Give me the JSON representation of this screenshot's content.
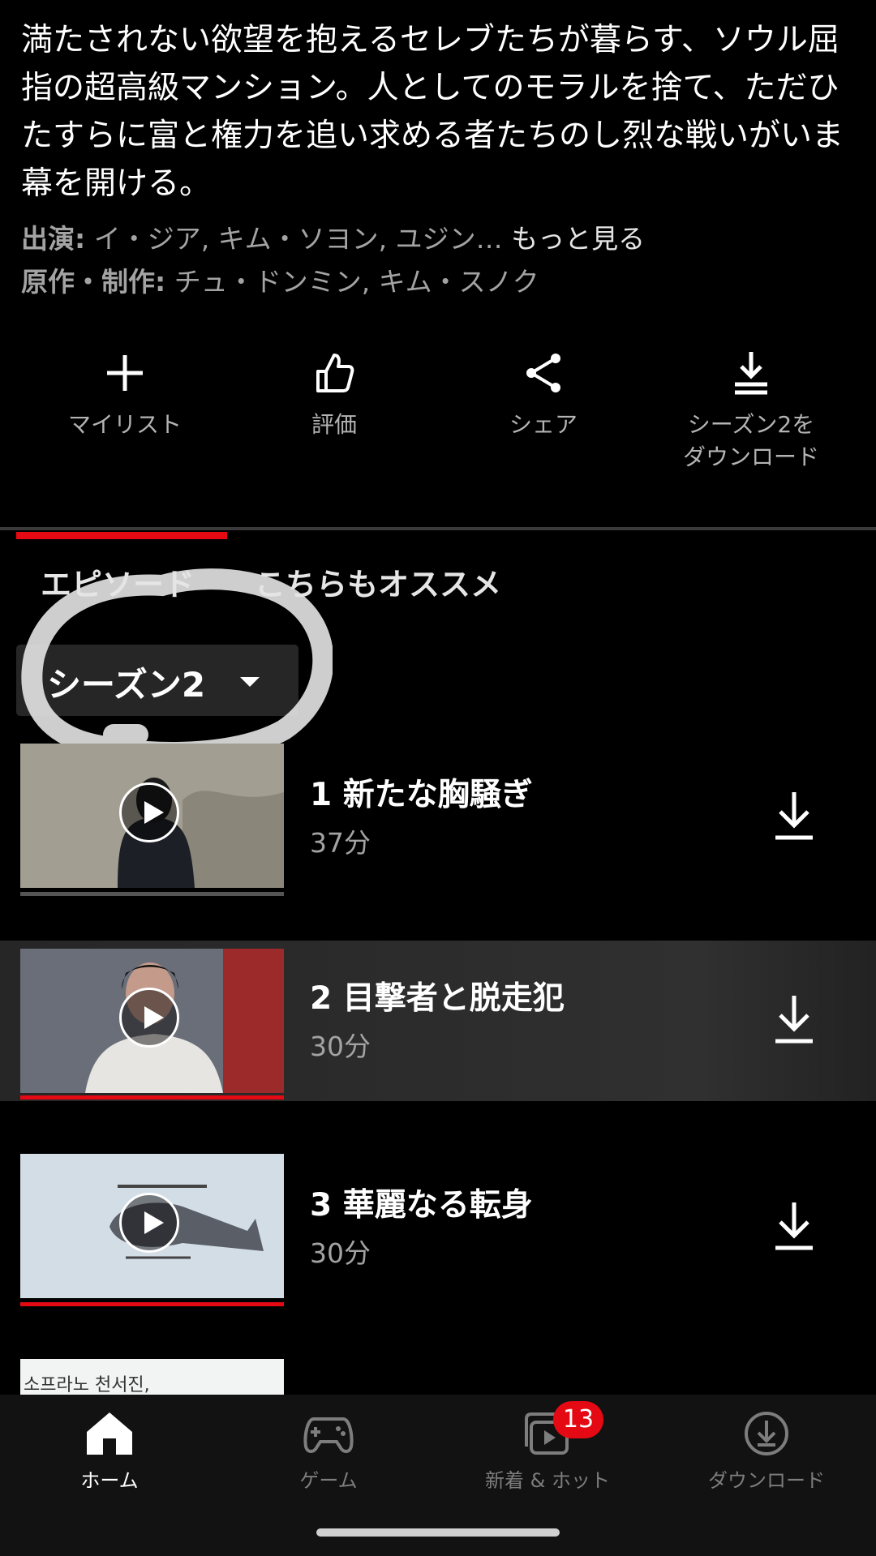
{
  "description": "満たされない欲望を抱えるセレブたちが暮らす、ソウル屈指の超高級マンション。人としてのモラルを捨て、ただひたすらに富と権力を追い求める者たちのし烈な戦いがいま幕を開ける。",
  "cast": {
    "label": "出演:",
    "names": " イ・ジア, キム・ソヨン, ユジン…",
    "more": " もっと見る"
  },
  "creators": {
    "label": "原作・制作:",
    "names": " チュ・ドンミン, キム・スノク"
  },
  "actions": [
    {
      "label": "マイリスト",
      "icon": "plus-icon"
    },
    {
      "label": "評価",
      "icon": "thumbs-up-icon"
    },
    {
      "label": "シェア",
      "icon": "share-icon"
    },
    {
      "label": "シーズン2を",
      "label2": "ダウンロード",
      "icon": "download-season-icon"
    }
  ],
  "tabs": [
    "エピソード",
    "こちらもオススメ"
  ],
  "season_selector": {
    "label": "シーズン2"
  },
  "episodes": [
    {
      "title": "1 新たな胸騒ぎ",
      "duration": "37分",
      "progress": 0.0
    },
    {
      "title": "2 目撃者と脱走犯",
      "duration": "30分",
      "progress": 1.0
    },
    {
      "title": "3 華麗なる転身",
      "duration": "30分",
      "progress": 1.0
    }
  ],
  "partial_thumb_text": "소프라노 천서진,",
  "bottom_nav": [
    {
      "label": "ホーム",
      "icon": "home-icon",
      "active": true
    },
    {
      "label": "ゲーム",
      "icon": "gamepad-icon",
      "active": false
    },
    {
      "label": "新着 & ホット",
      "icon": "new-hot-icon",
      "active": false
    },
    {
      "label": "ダウンロード",
      "icon": "download-circle-icon",
      "active": false
    }
  ],
  "badge_count": "13",
  "colors": {
    "accent": "#e50914",
    "background": "#000000",
    "secondary_text": "#a3a3a3"
  }
}
